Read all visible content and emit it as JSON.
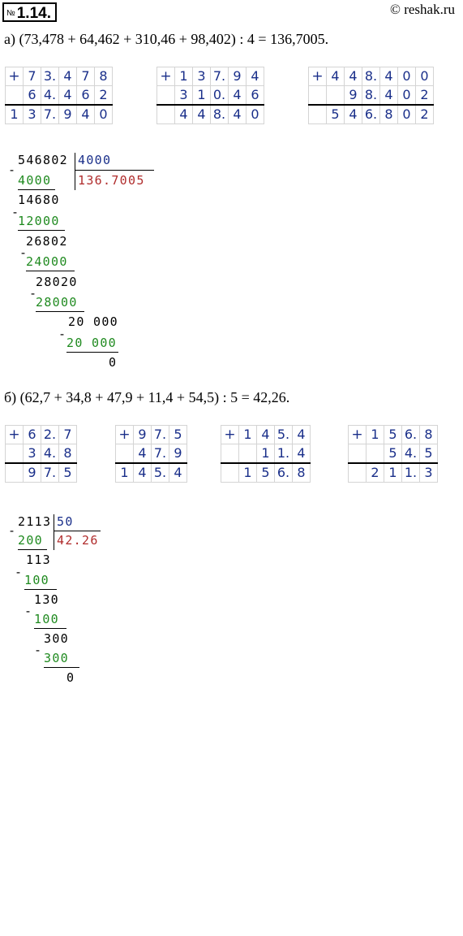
{
  "header": {
    "number_sign": "№",
    "number": "1.14.",
    "site": "© reshak.ru"
  },
  "part_a": {
    "equation": "а) (73,478 + 64,462 + 310,46 + 98,402) : 4 = 136,7005.",
    "additions": [
      {
        "rows": [
          [
            "+",
            "7",
            "3.",
            "4",
            "7",
            "8"
          ],
          [
            "",
            "6",
            "4.",
            "4",
            "6",
            "2"
          ],
          [
            "1",
            "3",
            "7.",
            "9",
            "4",
            "0"
          ]
        ]
      },
      {
        "rows": [
          [
            "+",
            "1",
            "3",
            "7.",
            "9",
            "4"
          ],
          [
            "",
            "3",
            "1",
            "0.",
            "4",
            "6"
          ],
          [
            "",
            "4",
            "4",
            "8.",
            "4",
            "0"
          ]
        ]
      },
      {
        "rows": [
          [
            "+",
            "4",
            "4",
            "8.",
            "4",
            "0",
            "0"
          ],
          [
            "",
            "",
            "9",
            "8.",
            "4",
            "0",
            "2"
          ],
          [
            "",
            "5",
            "4",
            "6.",
            "8",
            "0",
            "2"
          ]
        ]
      }
    ],
    "division": {
      "dividend": "546802",
      "divisor": "4000",
      "quotient": "136.7005",
      "steps": [
        "4000",
        "14680",
        "12000",
        "26802",
        "24000",
        "28020",
        "28000",
        "20 000",
        "20 000",
        "0"
      ]
    }
  },
  "part_b": {
    "equation": "б) (62,7 + 34,8 + 47,9 + 11,4 + 54,5) : 5 = 42,26.",
    "additions": [
      {
        "rows": [
          [
            "+",
            "6",
            "2.",
            "7"
          ],
          [
            "",
            "3",
            "4.",
            "8"
          ],
          [
            "",
            "9",
            "7.",
            "5"
          ]
        ]
      },
      {
        "rows": [
          [
            "+",
            "9",
            "7.",
            "5"
          ],
          [
            "",
            "4",
            "7.",
            "9"
          ],
          [
            "1",
            "4",
            "5.",
            "4"
          ]
        ]
      },
      {
        "rows": [
          [
            "+",
            "1",
            "4",
            "5.",
            "4"
          ],
          [
            "",
            "",
            "1",
            "1.",
            "4"
          ],
          [
            "",
            "1",
            "5",
            "6.",
            "8"
          ]
        ]
      },
      {
        "rows": [
          [
            "+",
            "1",
            "5",
            "6.",
            "8"
          ],
          [
            "",
            "",
            "5",
            "4.",
            "5"
          ],
          [
            "",
            "2",
            "1",
            "1.",
            "3"
          ]
        ]
      }
    ],
    "division": {
      "dividend": "2113",
      "divisor": "50",
      "quotient": "42.26",
      "steps": [
        "200",
        "113",
        "100",
        "130",
        "100",
        "300",
        "300",
        "0"
      ]
    }
  }
}
